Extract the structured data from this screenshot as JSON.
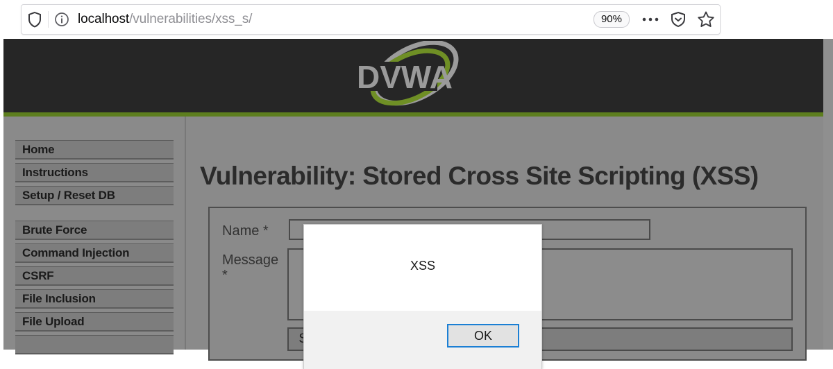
{
  "browser": {
    "url_host": "localhost",
    "url_path": "/vulnerabilities/xss_s/",
    "zoom_level": "90%",
    "shield_icon": "shield-icon",
    "info_icon": "info-circle-icon",
    "menu_icon": "ellipsis-menu-icon",
    "tracking_icon": "tracking-protection-shield-icon",
    "bookmark_icon": "star-bookmark-icon"
  },
  "site": {
    "logo_text": "DVWA",
    "header_bg": "#262626",
    "accent_green": "#5d7e1e",
    "body_gray": "#8a8a8a"
  },
  "sidebar": {
    "items": [
      {
        "label": "Home"
      },
      {
        "label": "Instructions"
      },
      {
        "label": "Setup / Reset DB"
      },
      {
        "label": "Brute Force"
      },
      {
        "label": "Command Injection"
      },
      {
        "label": "CSRF"
      },
      {
        "label": "File Inclusion"
      },
      {
        "label": "File Upload"
      }
    ]
  },
  "main": {
    "page_title": "Vulnerability: Stored Cross Site Scripting (XSS)",
    "form": {
      "name_label": "Name *",
      "name_value": "",
      "message_label": "Message *",
      "message_value": "",
      "submit_label": "Sign Guestbook"
    }
  },
  "dialog": {
    "message": "XSS",
    "ok_label": "OK",
    "ok_border_color": "#1b7fd4"
  }
}
